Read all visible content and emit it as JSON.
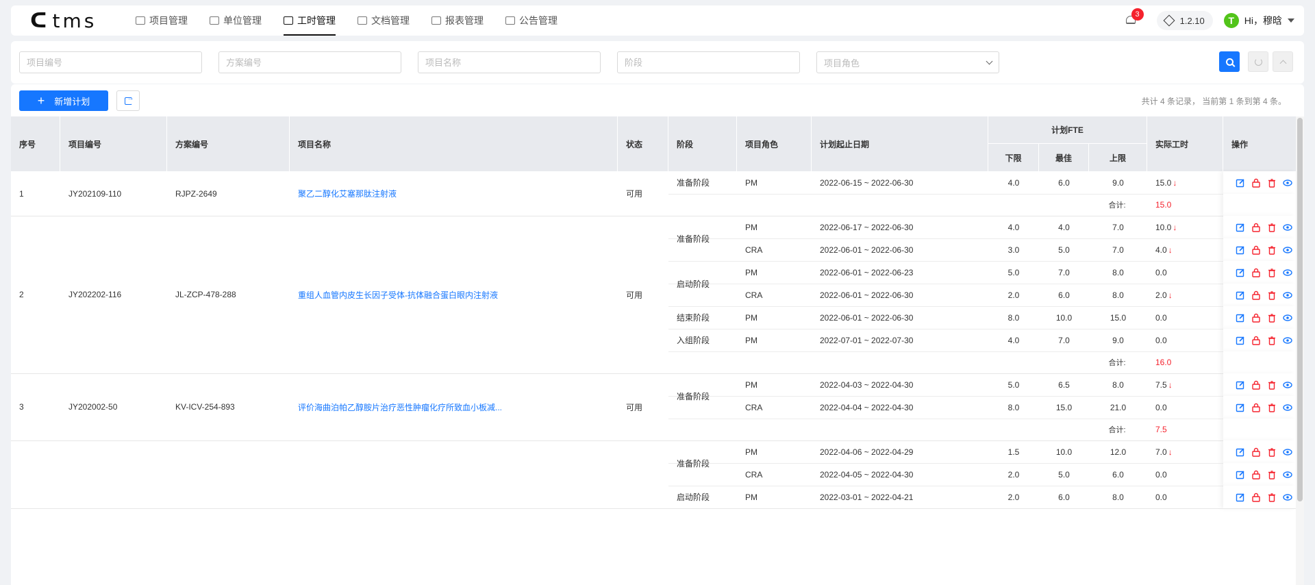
{
  "header": {
    "logo_text": "tms",
    "nav": [
      {
        "label": "项目管理",
        "active": false
      },
      {
        "label": "单位管理",
        "active": false
      },
      {
        "label": "工时管理",
        "active": true
      },
      {
        "label": "文档管理",
        "active": false
      },
      {
        "label": "报表管理",
        "active": false
      },
      {
        "label": "公告管理",
        "active": false
      }
    ],
    "notification_count": "3",
    "version": "1.2.10",
    "avatar_letter": "T",
    "greeting": "Hi，穆晗"
  },
  "filters": {
    "project_code_placeholder": "项目编号",
    "scheme_code_placeholder": "方案编号",
    "project_name_placeholder": "项目名称",
    "stage_placeholder": "阶段",
    "role_placeholder": "项目角色"
  },
  "toolbar": {
    "add_label": "新增计划",
    "summary": "共计 4 条记录， 当前第 1 条到第  4 条。"
  },
  "table": {
    "headers": {
      "seq": "序号",
      "project_code": "项目编号",
      "scheme_code": "方案编号",
      "project_name": "项目名称",
      "status": "状态",
      "stage": "阶段",
      "role": "项目角色",
      "date_range": "计划起止日期",
      "fte_group": "计划FTE",
      "fte_min": "下限",
      "fte_best": "最佳",
      "fte_max": "上限",
      "actual_hours": "实际工时",
      "ops": "操作"
    },
    "total_label": "合计:",
    "projects": [
      {
        "seq": "1",
        "code": "JY202109-110",
        "scheme": "RJPZ-2649",
        "name": "聚乙二醇化艾塞那肽注射液",
        "status": "可用",
        "stages": [
          {
            "name": "准备阶段",
            "rows": [
              {
                "role": "PM",
                "date": "2022-06-15 ~ 2022-06-30",
                "min": "4.0",
                "best": "6.0",
                "max": "9.0",
                "actual": "15.0",
                "down": true
              }
            ]
          }
        ],
        "total": "15.0"
      },
      {
        "seq": "2",
        "code": "JY202202-116",
        "scheme": "JL-ZCP-478-288",
        "name": "重组人血管内皮生长因子受体-抗体融合蛋白眼内注射液",
        "status": "可用",
        "stages": [
          {
            "name": "准备阶段",
            "rows": [
              {
                "role": "PM",
                "date": "2022-06-17 ~ 2022-06-30",
                "min": "4.0",
                "best": "4.0",
                "max": "7.0",
                "actual": "10.0",
                "down": true
              },
              {
                "role": "CRA",
                "date": "2022-06-01 ~ 2022-06-30",
                "min": "3.0",
                "best": "5.0",
                "max": "7.0",
                "actual": "4.0",
                "down": true
              }
            ]
          },
          {
            "name": "启动阶段",
            "rows": [
              {
                "role": "PM",
                "date": "2022-06-01 ~ 2022-06-23",
                "min": "5.0",
                "best": "7.0",
                "max": "8.0",
                "actual": "0.0",
                "down": false
              },
              {
                "role": "CRA",
                "date": "2022-06-01 ~ 2022-06-30",
                "min": "2.0",
                "best": "6.0",
                "max": "8.0",
                "actual": "2.0",
                "down": true
              }
            ]
          },
          {
            "name": "结束阶段",
            "rows": [
              {
                "role": "PM",
                "date": "2022-06-01 ~ 2022-06-30",
                "min": "8.0",
                "best": "10.0",
                "max": "15.0",
                "actual": "0.0",
                "down": false
              }
            ]
          },
          {
            "name": "入组阶段",
            "rows": [
              {
                "role": "PM",
                "date": "2022-07-01 ~ 2022-07-30",
                "min": "4.0",
                "best": "7.0",
                "max": "9.0",
                "actual": "0.0",
                "down": false
              }
            ]
          }
        ],
        "total": "16.0"
      },
      {
        "seq": "3",
        "code": "JY202002-50",
        "scheme": "KV-ICV-254-893",
        "name": "评价海曲泊帕乙醇胺片治疗恶性肿瘤化疗所致血小板减...",
        "status": "可用",
        "stages": [
          {
            "name": "准备阶段",
            "rows": [
              {
                "role": "PM",
                "date": "2022-04-03 ~ 2022-04-30",
                "min": "5.0",
                "best": "6.5",
                "max": "8.0",
                "actual": "7.5",
                "down": true
              },
              {
                "role": "CRA",
                "date": "2022-04-04 ~ 2022-04-30",
                "min": "8.0",
                "best": "15.0",
                "max": "21.0",
                "actual": "0.0",
                "down": false
              }
            ]
          }
        ],
        "total": "7.5"
      },
      {
        "seq": "",
        "code": "",
        "scheme": "",
        "name": "",
        "status": "",
        "stages": [
          {
            "name": "准备阶段",
            "rows": [
              {
                "role": "PM",
                "date": "2022-04-06 ~ 2022-04-29",
                "min": "1.5",
                "best": "10.0",
                "max": "12.0",
                "actual": "7.0",
                "down": true
              },
              {
                "role": "CRA",
                "date": "2022-04-05 ~ 2022-04-30",
                "min": "2.0",
                "best": "5.0",
                "max": "6.0",
                "actual": "0.0",
                "down": false
              }
            ]
          },
          {
            "name": "启动阶段",
            "rows": [
              {
                "role": "PM",
                "date": "2022-03-01 ~ 2022-04-21",
                "min": "2.0",
                "best": "6.0",
                "max": "8.0",
                "actual": "0.0",
                "down": false
              }
            ]
          }
        ],
        "total": ""
      }
    ]
  },
  "colors": {
    "accent": "#1677ff",
    "danger": "#f5222d",
    "header_bg": "#e8eaee"
  }
}
